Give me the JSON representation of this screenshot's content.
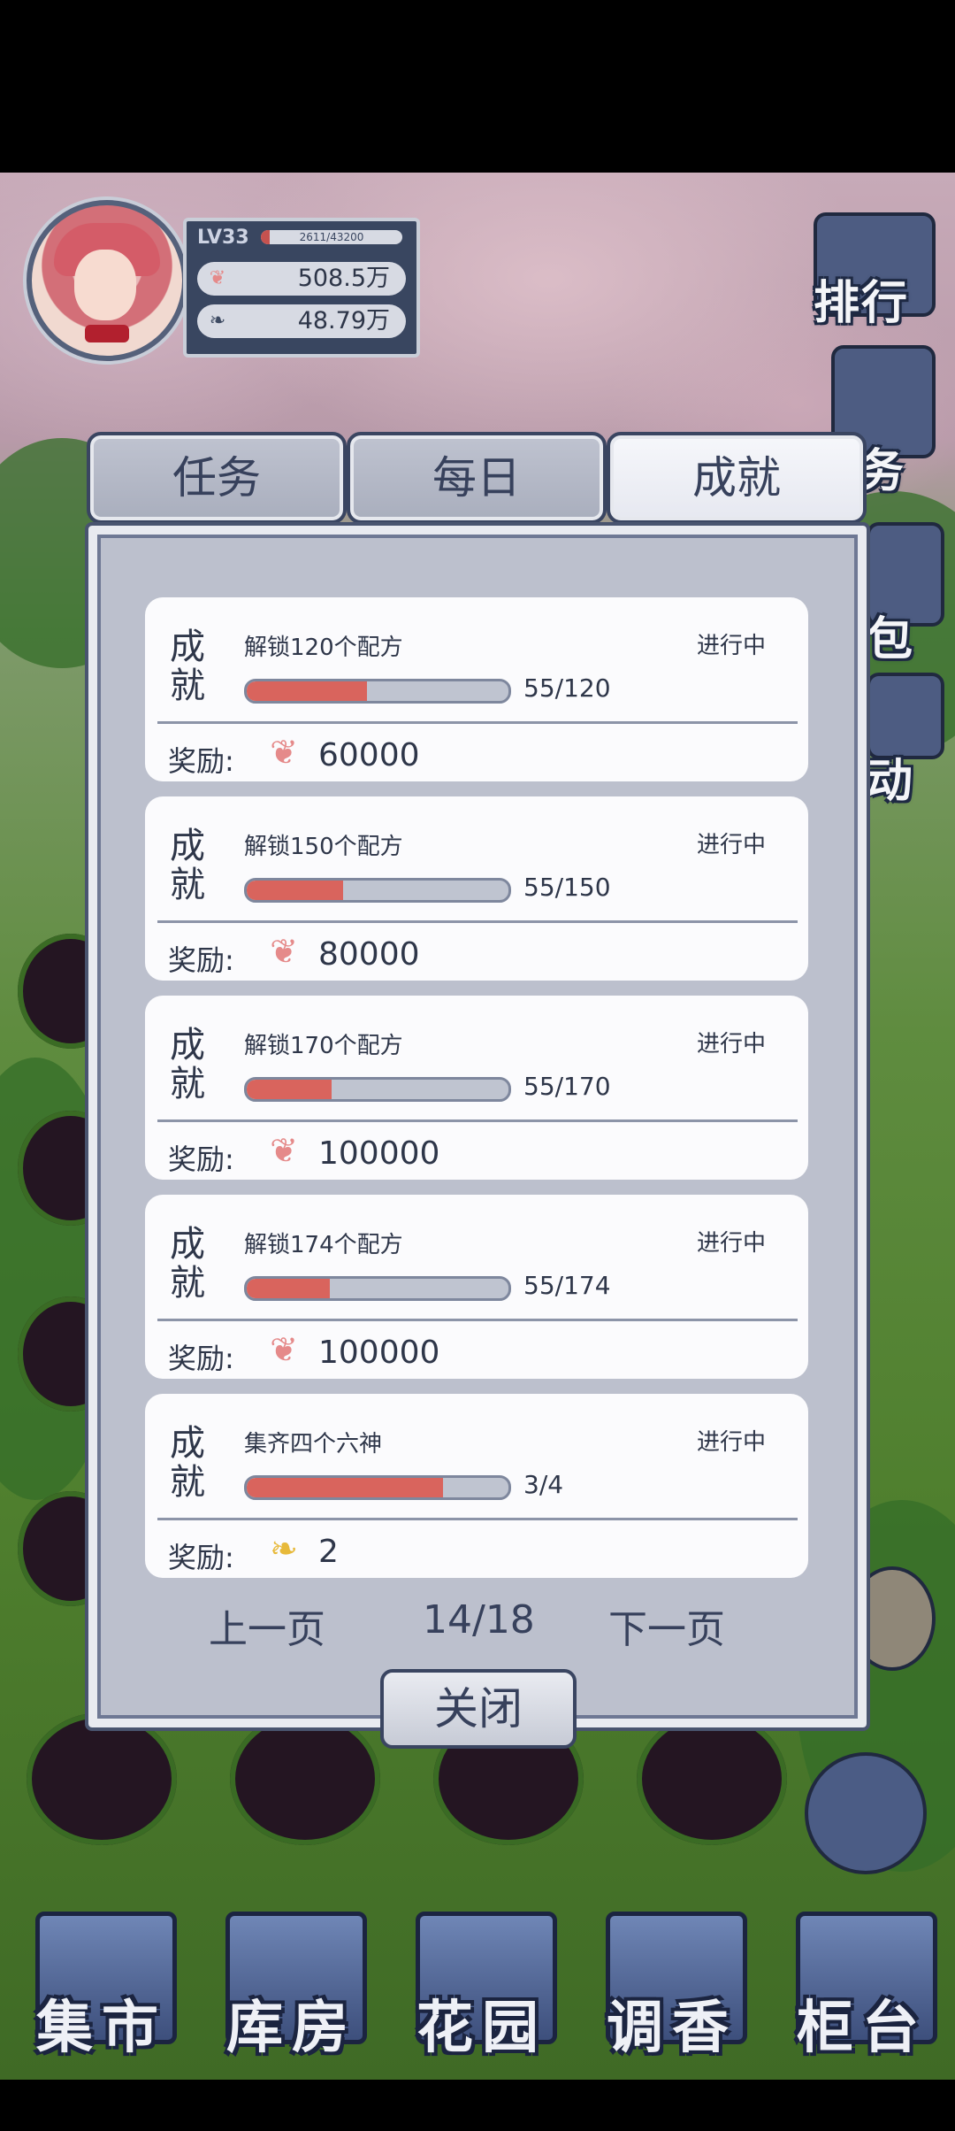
{
  "player": {
    "level": "LV33",
    "xp_text": "2611/43200",
    "xp_fraction": 0.06,
    "petals": "508.5万",
    "leaves": "48.79万"
  },
  "side_buttons": [
    "排行",
    "务",
    "包",
    "动"
  ],
  "tabs": [
    {
      "label": "任务",
      "active": false
    },
    {
      "label": "每日",
      "active": false
    },
    {
      "label": "成就",
      "active": true
    }
  ],
  "achievements": [
    {
      "type": "成就",
      "title": "解锁120个配方",
      "status": "进行中",
      "progress": "55/120",
      "fraction": 0.458,
      "reward_label": "奖励:",
      "reward_icon": "petal-icon",
      "reward_value": "60000"
    },
    {
      "type": "成就",
      "title": "解锁150个配方",
      "status": "进行中",
      "progress": "55/150",
      "fraction": 0.367,
      "reward_label": "奖励:",
      "reward_icon": "petal-icon",
      "reward_value": "80000"
    },
    {
      "type": "成就",
      "title": "解锁170个配方",
      "status": "进行中",
      "progress": "55/170",
      "fraction": 0.324,
      "reward_label": "奖励:",
      "reward_icon": "petal-icon",
      "reward_value": "100000"
    },
    {
      "type": "成就",
      "title": "解锁174个配方",
      "status": "进行中",
      "progress": "55/174",
      "fraction": 0.316,
      "reward_label": "奖励:",
      "reward_icon": "petal-icon",
      "reward_value": "100000"
    },
    {
      "type": "成就",
      "title": "集齐四个六神",
      "status": "进行中",
      "progress": "3/4",
      "fraction": 0.75,
      "reward_label": "奖励:",
      "reward_icon": "gold-leaf-icon",
      "reward_value": "2"
    }
  ],
  "pager": {
    "prev": "上一页",
    "page": "14/18",
    "next": "下一页"
  },
  "close_label": "关闭",
  "nav": [
    "集市",
    "库房",
    "花园",
    "调香",
    "柜台"
  ],
  "colors": {
    "progress_fill": "#d9645d",
    "panel": "#bcc0cd",
    "card": "#fbfbfd",
    "text": "#2e3649"
  }
}
